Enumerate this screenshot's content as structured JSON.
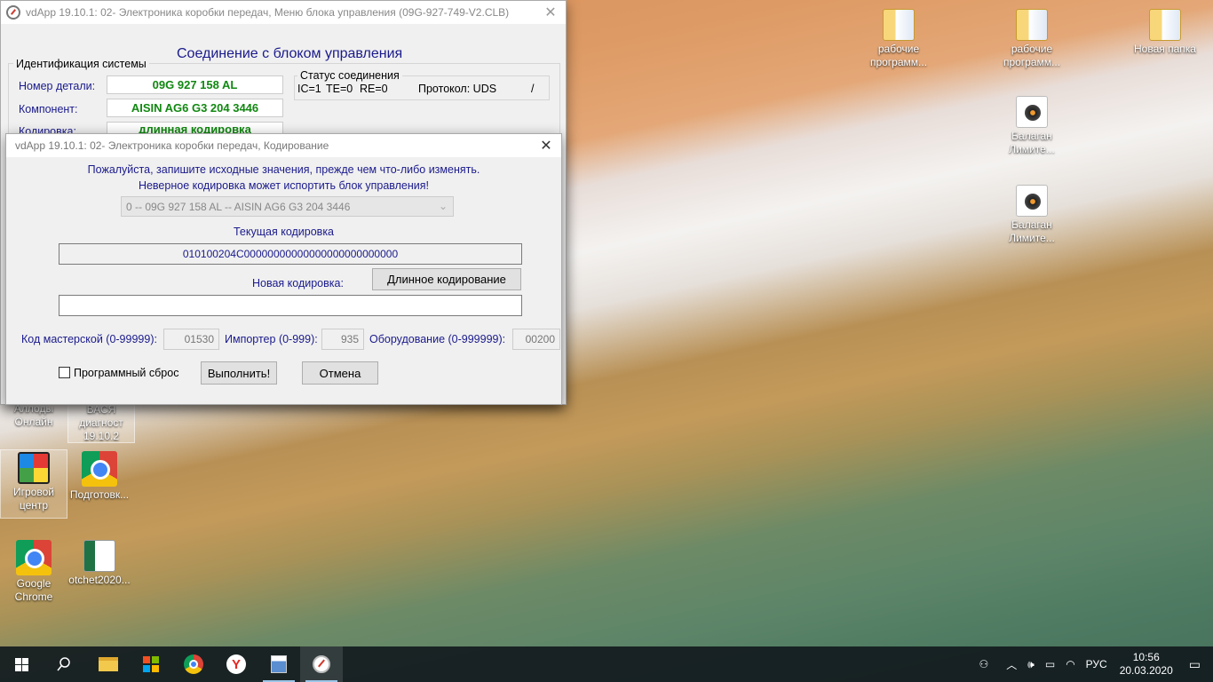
{
  "desktop": {
    "icons_right": [
      {
        "label": "рабочие программ...",
        "icon": "folder-icon"
      },
      {
        "label": "рабочие программ...",
        "icon": "folder-icon"
      },
      {
        "label": "Новая папка",
        "icon": "folder-icon"
      },
      {
        "label": "Балаган Лимите...",
        "icon": "media-file-icon"
      },
      {
        "label": "Балаган Лимите...",
        "icon": "media-file-icon"
      }
    ],
    "icons_left": [
      {
        "label": "Аллоды Онлайн",
        "icon": "game-icon"
      },
      {
        "label": "ВАСЯ диагност 19.10.2",
        "icon": "app-icon"
      },
      {
        "label": "Игровой центр",
        "icon": "cube-icon"
      },
      {
        "label": "Подготовк...",
        "icon": "chrome-icon"
      },
      {
        "label": "Google Chrome",
        "icon": "chrome-icon"
      },
      {
        "label": "otchet2020...",
        "icon": "excel-icon"
      }
    ]
  },
  "main_window": {
    "title": "vdApp 19.10.1: 02- Электроника коробки передач,  Меню блока управления (09G-927-749-V2.CLB)",
    "heading": "Соединение с блоком управления",
    "ident_group": "Идентификация системы",
    "part_label": "Номер детали:",
    "part_value": "09G 927 158 AL",
    "component_label": "Компонент:",
    "component_value": "AISIN AG6 G3  204 3446",
    "coding_label": "Кодировка:",
    "coding_value": "длинная кодировка",
    "status_group": "Статус соединения",
    "status_ic": "IC=1",
    "status_te": "TE=0",
    "status_re": "RE=0",
    "protocol": "Протокол: UDS",
    "status_slash": "/"
  },
  "coding_dialog": {
    "title": "vdApp 19.10.1: 02- Электроника коробки передач,  Кодирование",
    "warning1": "Пожалуйста, запишите исходные значения, прежде чем что-либо изменять.",
    "warning2": "Неверное кодировка может испортить блок управления!",
    "select_value": "0 -- 09G 927 158 AL -- AISIN AG6 G3  204 3446",
    "current_label": "Текущая кодировка",
    "current_value": "010100204C00000000000000000000000000",
    "new_label": "Новая кодировка:",
    "long_coding_button": "Длинное кодирование",
    "new_value": "",
    "workshop_label": "Код мастерской (0-99999):",
    "workshop_value": "01530",
    "importer_label": "Импортер (0-999):",
    "importer_value": "935",
    "equipment_label": "Оборудование (0-999999):",
    "equipment_value": "00200",
    "soft_reset_label": "Программный сброс",
    "execute_button": "Выполнить!",
    "cancel_button": "Отмена"
  },
  "taskbar": {
    "language": "РУС",
    "time": "10:56",
    "date": "20.03.2020"
  }
}
